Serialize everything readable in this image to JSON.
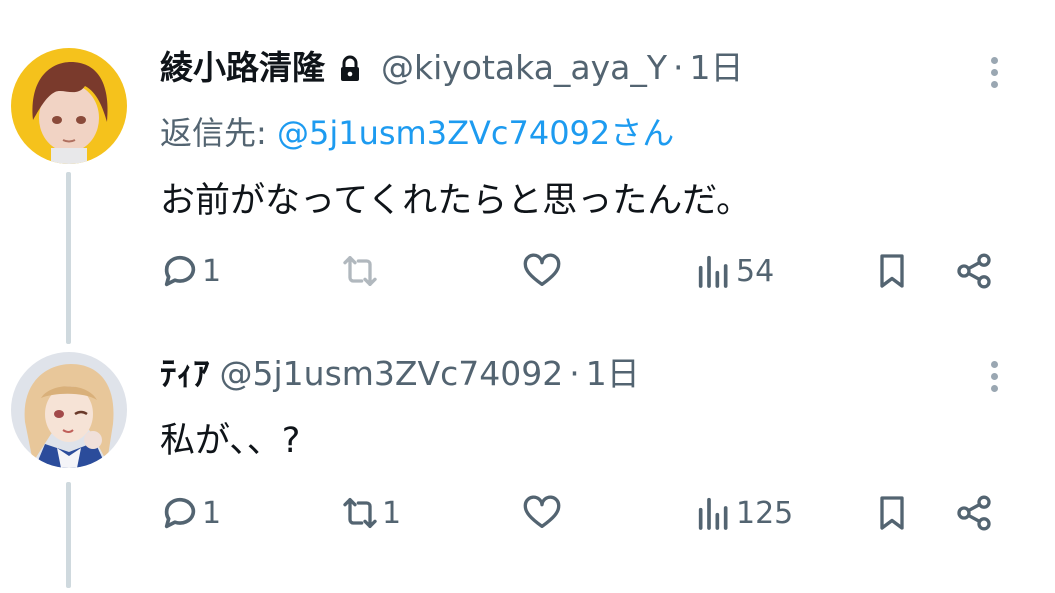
{
  "tweets": [
    {
      "display_name": "綾小路清隆",
      "handle": "@kiyotaka_aya_Y",
      "separator": "·",
      "time": "1日",
      "reply_prefix": "返信先: ",
      "reply_mention": "@5j1usm3ZVc74092さん",
      "text": "お前がなってくれたらと思ったんだ。",
      "replies": "1",
      "retweets": "",
      "likes": "",
      "views": "54",
      "avatar_colors": {
        "bg": "#f5c21c",
        "hair": "#7a3a2c",
        "skin": "#f1d3c4"
      }
    },
    {
      "display_name": "ﾃｨｱ",
      "handle": "@5j1usm3ZVc74092",
      "separator": "·",
      "time": "1日",
      "text": "私が、、?",
      "replies": "1",
      "retweets": "1",
      "likes": "",
      "views": "125",
      "avatar_colors": {
        "bg": "#dfe3ea",
        "hair": "#e8c79a",
        "skin": "#f6e3d6",
        "cloth": "#2b4c9b"
      }
    }
  ],
  "colors": {
    "text": "#0f1419",
    "secondary": "#536471",
    "link": "#1d9bf0",
    "thread_line": "#cfd9de"
  }
}
